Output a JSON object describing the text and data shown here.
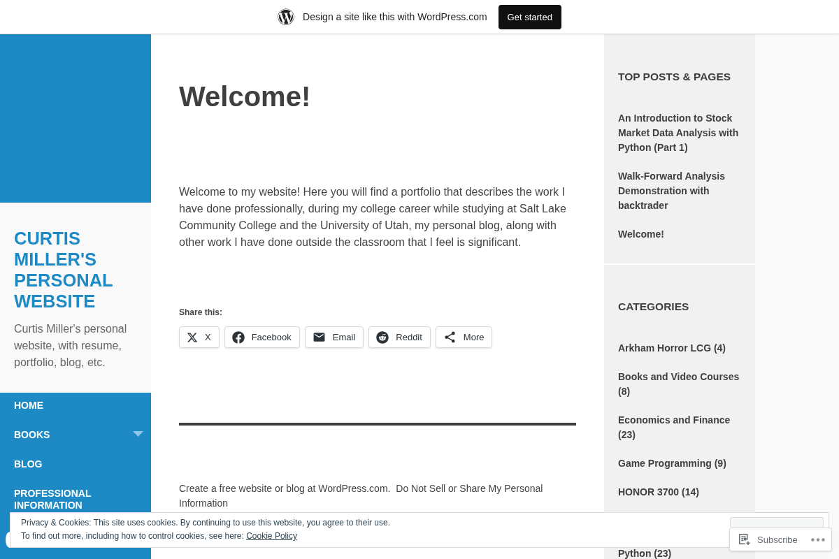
{
  "top_bar": {
    "message": "Design a site like this with WordPress.com",
    "button": "Get started"
  },
  "site": {
    "title": "CURTIS MILLER'S PERSONAL WEBSITE",
    "description": "Curtis Miller's personal website, with resume, portfolio, blog, etc."
  },
  "nav": [
    {
      "label": "HOME",
      "submenu": false
    },
    {
      "label": "BOOKS",
      "submenu": true
    },
    {
      "label": "BLOG",
      "submenu": false
    },
    {
      "label": "PROFESSIONAL INFORMATION",
      "submenu": false
    }
  ],
  "post": {
    "title": "Welcome!",
    "body": "Welcome to my website! Here you will find a portfolio that describes the work I have done professionally, during my college career while studying at Salt Lake Community College and the University of Utah, my personal blog, along with other work I have done outside the classroom that I feel is significant.",
    "share_heading": "Share this:",
    "share_buttons": [
      {
        "kind": "x",
        "label": "X"
      },
      {
        "kind": "facebook",
        "label": "Facebook"
      },
      {
        "kind": "email",
        "label": "Email"
      },
      {
        "kind": "reddit",
        "label": "Reddit"
      },
      {
        "kind": "more",
        "label": "More"
      }
    ]
  },
  "footer": {
    "links": [
      "Create a free website or blog at WordPress.com.",
      "Do Not Sell or Share My Personal Information"
    ]
  },
  "widgets": [
    {
      "title": "TOP POSTS & PAGES",
      "items": [
        "An Introduction to Stock Market Data Analysis with Python (Part 1)",
        "Walk-Forward Analysis Demonstration with backtrader",
        "Welcome!"
      ]
    },
    {
      "title": "CATEGORIES",
      "items": [
        "Arkham Horror LCG (4)",
        "Books and Video Courses (8)",
        "Economics and Finance (23)",
        "Game Programming (9)",
        "HONOR 3700 (14)",
        "Python (23)"
      ]
    }
  ],
  "cookie_banner": {
    "text": "Privacy & Cookies: This site uses cookies. By continuing to use this website, you agree to their use.",
    "more_text": "To find out more, including how to control cookies, see here:",
    "link": "Cookie Policy"
  },
  "subscribe_bar": {
    "label": "Subscribe"
  }
}
